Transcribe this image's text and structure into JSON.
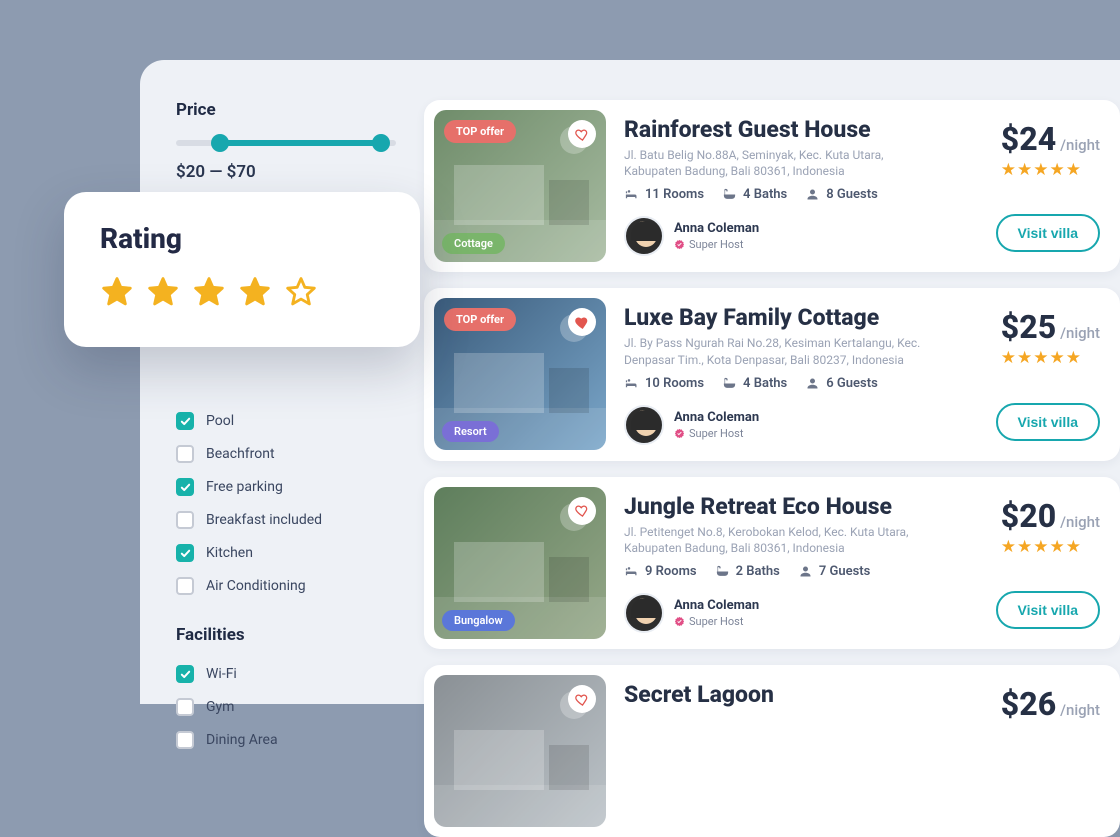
{
  "sidebar": {
    "price": {
      "title": "Price",
      "range_display": "$20 — $70"
    },
    "facilities_top": {
      "items": [
        {
          "label": "Pool",
          "checked": true
        },
        {
          "label": "Beachfront",
          "checked": false
        },
        {
          "label": "Free parking",
          "checked": true
        },
        {
          "label": "Breakfast included",
          "checked": false
        },
        {
          "label": "Kitchen",
          "checked": true
        },
        {
          "label": "Air Conditioning",
          "checked": false
        }
      ]
    },
    "facilities": {
      "title": "Facilities",
      "items": [
        {
          "label": "Wi-Fi",
          "checked": true
        },
        {
          "label": "Gym",
          "checked": false
        },
        {
          "label": "Dining Area",
          "checked": false
        }
      ]
    }
  },
  "rating_popover": {
    "title": "Rating",
    "active_stars": 4,
    "total_stars": 5
  },
  "listings": [
    {
      "title": "Rainforest Guest House",
      "address": "Jl. Batu Belig No.88A, Seminyak, Kec. Kuta Utara, Kabupaten Badung, Bali 80361, Indonesia",
      "rooms": "11 Rooms",
      "baths": "4 Baths",
      "guests": "8 Guests",
      "host_name": "Anna Coleman",
      "host_label": "Super Host",
      "top_offer": "TOP offer",
      "tag": "Cottage",
      "tag_style": "cottage",
      "heart_filled": false,
      "thumb_style": "",
      "price": "$24",
      "per_night": "/night",
      "stars": 5,
      "cta": "Visit villa"
    },
    {
      "title": "Luxe Bay Family Cottage",
      "address": "Jl. By Pass Ngurah Rai No.28, Kesiman Kertalangu, Kec. Denpasar Tim., Kota Denpasar, Bali 80237, Indonesia",
      "rooms": "10 Rooms",
      "baths": "4 Baths",
      "guests": "6 Guests",
      "host_name": "Anna Coleman",
      "host_label": "Super Host",
      "top_offer": "TOP offer",
      "tag": "Resort",
      "tag_style": "resort",
      "heart_filled": true,
      "thumb_style": "blue",
      "price": "$25",
      "per_night": "/night",
      "stars": 5,
      "cta": "Visit villa"
    },
    {
      "title": "Jungle Retreat Eco House",
      "address": "Jl. Petitenget No.8, Kerobokan Kelod, Kec. Kuta Utara, Kabupaten Badung, Bali 80361, Indonesia",
      "rooms": "9 Rooms",
      "baths": "2 Baths",
      "guests": "7 Guests",
      "host_name": "Anna Coleman",
      "host_label": "Super Host",
      "top_offer": null,
      "tag": "Bungalow",
      "tag_style": "bungalow",
      "heart_filled": false,
      "thumb_style": "green2",
      "price": "$20",
      "per_night": "/night",
      "stars": 5,
      "cta": "Visit villa"
    },
    {
      "title": "Secret Lagoon",
      "address": "",
      "rooms": "",
      "baths": "",
      "guests": "",
      "host_name": "",
      "host_label": "",
      "top_offer": null,
      "tag": null,
      "tag_style": "",
      "heart_filled": false,
      "thumb_style": "grey",
      "price": "$26",
      "per_night": "/night",
      "stars": 0,
      "cta": ""
    }
  ]
}
